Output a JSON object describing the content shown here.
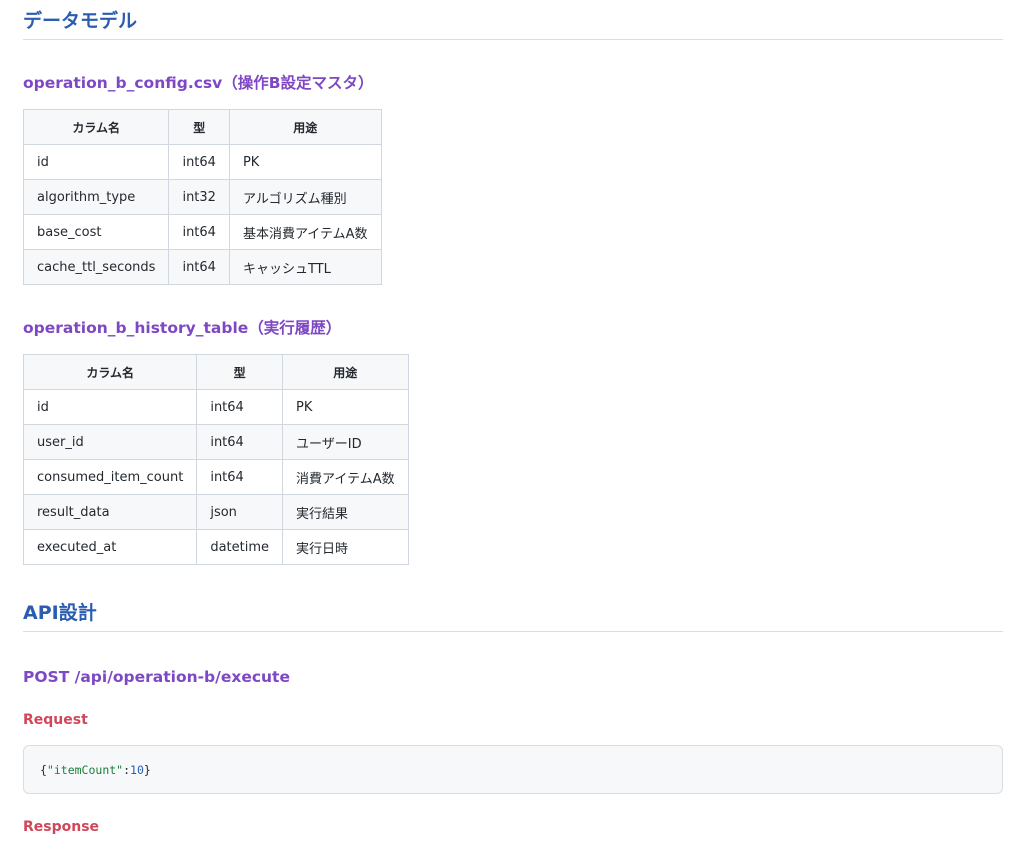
{
  "sections": {
    "data_model": {
      "title": "データモデル"
    },
    "api_design": {
      "title": "API設計"
    }
  },
  "config_table": {
    "title": "operation_b_config.csv（操作B設定マスタ）",
    "headers": [
      "カラム名",
      "型",
      "用途"
    ],
    "rows": [
      [
        "id",
        "int64",
        "PK"
      ],
      [
        "algorithm_type",
        "int32",
        "アルゴリズム種別"
      ],
      [
        "base_cost",
        "int64",
        "基本消費アイテムA数"
      ],
      [
        "cache_ttl_seconds",
        "int64",
        "キャッシュTTL"
      ]
    ]
  },
  "history_table": {
    "title": "operation_b_history_table（実行履歴）",
    "headers": [
      "カラム名",
      "型",
      "用途"
    ],
    "rows": [
      [
        "id",
        "int64",
        "PK"
      ],
      [
        "user_id",
        "int64",
        "ユーザーID"
      ],
      [
        "consumed_item_count",
        "int64",
        "消費アイテムA数"
      ],
      [
        "result_data",
        "json",
        "実行結果"
      ],
      [
        "executed_at",
        "datetime",
        "実行日時"
      ]
    ]
  },
  "endpoint": {
    "title": "POST /api/operation-b/execute",
    "request_label": "Request",
    "request_code": {
      "open": "{ ",
      "key": "\"itemCount\"",
      "colon": ": ",
      "value": "10",
      "close": " }"
    },
    "response_label": "Response"
  },
  "colors": {
    "h2": "#2a5db0",
    "h3": "#7e48c4",
    "h4": "#d1475a",
    "code_string": "#1a7f37",
    "code_number": "#2a5db0"
  }
}
